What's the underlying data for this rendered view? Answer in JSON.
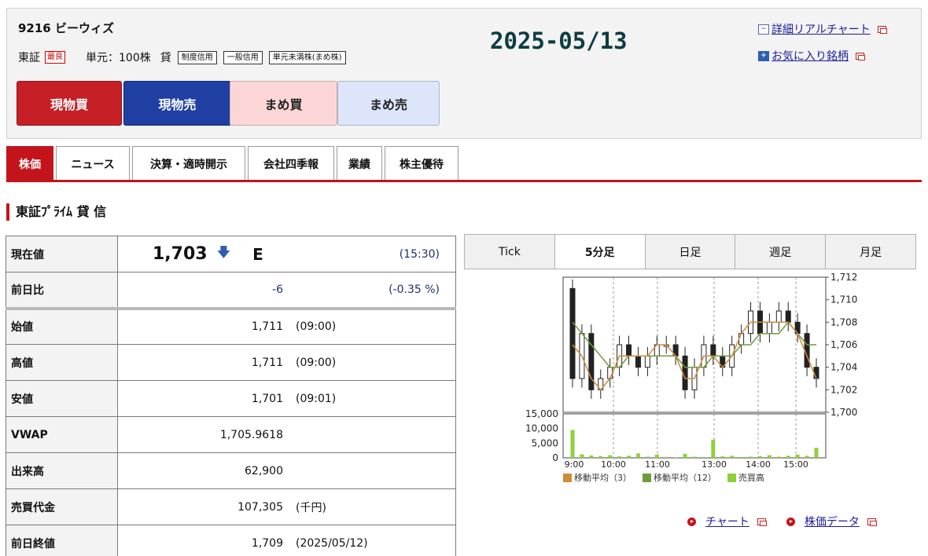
{
  "header": {
    "code_name": "9216 ビーウィズ",
    "market": "東証",
    "market_mark": "最良",
    "unit": "単元：100株",
    "lend_label": "貸",
    "tags": [
      "制度信用",
      "一般信用",
      "単元未満株(まめ株)"
    ],
    "date": "2025-05/13",
    "link_chart": "詳細リアルチャート",
    "link_fav": "お気に入り銘柄"
  },
  "buttons": {
    "spot_buy": "現物買",
    "spot_sell": "現物売",
    "mame_buy": "まめ買",
    "mame_sell": "まめ売"
  },
  "tabs": [
    "株価",
    "ニュース",
    "決算・適時開示",
    "会社四季報",
    "業績",
    "株主優待"
  ],
  "section_title": "東証ﾌﾟﾗｲﾑ 貸 信",
  "quote": {
    "current_label": "現在値",
    "current_value": "1,703",
    "current_flag": "E",
    "current_time": "(15:30)",
    "change_label": "前日比",
    "change_value": "-6",
    "change_pct": "(-0.35 %)",
    "rows": [
      {
        "label": "始値",
        "value": "1,711",
        "sub": "(09:00)"
      },
      {
        "label": "高値",
        "value": "1,711",
        "sub": "(09:00)"
      },
      {
        "label": "安値",
        "value": "1,701",
        "sub": "(09:01)"
      },
      {
        "label": "VWAP",
        "value": "1,705.9618",
        "sub": ""
      },
      {
        "label": "出来高",
        "value": "62,900",
        "sub": ""
      },
      {
        "label": "売買代金",
        "value": "107,305",
        "sub": "(千円)"
      },
      {
        "label": "前日終値",
        "value": "1,709",
        "sub": "(2025/05/12)"
      }
    ]
  },
  "chart_tabs": [
    "Tick",
    "5分足",
    "日足",
    "週足",
    "月足"
  ],
  "chart_data": {
    "type": "line",
    "title": "",
    "x": [
      "9:00",
      "10:00",
      "11:00",
      "13:00",
      "14:00",
      "15:00"
    ],
    "price_ticks": [
      "1,712",
      "1,710",
      "1,708",
      "1,706",
      "1,704",
      "1,702",
      "1,700"
    ],
    "price_ylim": [
      1700,
      1712
    ],
    "volume_ticks": [
      "15,000",
      "10,000",
      "5,000",
      "0"
    ],
    "volume_ylim": [
      0,
      15000
    ],
    "candles_close": [
      1703,
      1707,
      1702,
      1703,
      1704,
      1706,
      1705,
      1704,
      1705,
      1706,
      1706,
      1705,
      1702,
      1704,
      1706,
      1705,
      1704,
      1706,
      1707,
      1709,
      1707,
      1708,
      1709,
      1708,
      1707,
      1704,
      1703
    ],
    "ma3": [
      1706,
      1705,
      1703,
      1702,
      1703,
      1705,
      1705,
      1705,
      1705,
      1706,
      1706,
      1705,
      1703,
      1703,
      1705,
      1705,
      1704,
      1705,
      1707,
      1708,
      1708,
      1708,
      1708,
      1708,
      1707,
      1705,
      1703
    ],
    "ma12": [
      1708,
      1707,
      1706,
      1705,
      1704,
      1704,
      1705,
      1705,
      1705,
      1705,
      1705,
      1705,
      1704,
      1704,
      1704,
      1705,
      1705,
      1705,
      1706,
      1706,
      1707,
      1707,
      1707,
      1708,
      1707,
      1706,
      1706
    ],
    "volume": [
      9500,
      1200,
      800,
      600,
      900,
      500,
      700,
      1500,
      400,
      1100,
      300,
      200,
      1400,
      400,
      300,
      6200,
      500,
      700,
      300,
      400,
      600,
      900,
      400,
      700,
      1100,
      700,
      3400
    ],
    "series": [
      {
        "name": "移動平均（3）",
        "color": "#d08a3e"
      },
      {
        "name": "移動平均（12）",
        "color": "#6f9b3a"
      },
      {
        "name": "売買高",
        "color": "#8fd13a"
      }
    ]
  },
  "bottom_links": {
    "chart": "チャート",
    "data": "株価データ"
  }
}
